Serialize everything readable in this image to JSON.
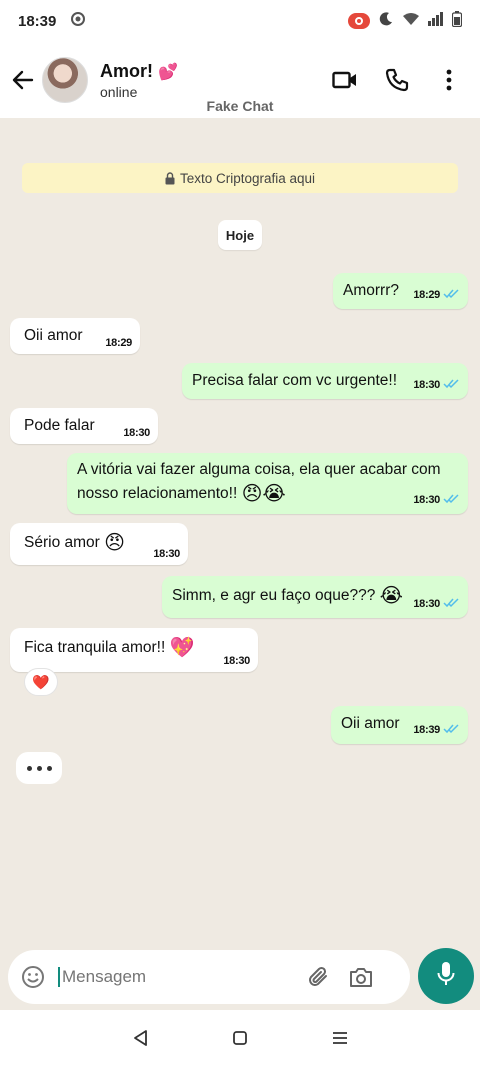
{
  "status_bar": {
    "time": "18:39"
  },
  "header": {
    "contact_name": "Amor!",
    "name_emoji": "💕",
    "status": "online",
    "app_label": "Fake Chat"
  },
  "chat": {
    "encryption_notice": "Texto Criptografia aqui",
    "date_divider": "Hoje",
    "messages": [
      {
        "dir": "out",
        "text": "Amorrr?",
        "time": "18:29",
        "read": true
      },
      {
        "dir": "in",
        "text": "Oii amor",
        "time": "18:29"
      },
      {
        "dir": "out",
        "text": "Precisa falar com vc urgente!!",
        "time": "18:30",
        "read": true
      },
      {
        "dir": "in",
        "text": "Pode falar",
        "time": "18:30"
      },
      {
        "dir": "out",
        "text_line1": "A vitória vai fazer alguma coisa, ela quer acabar com",
        "text_line2": "nosso relacionamento!!",
        "emojis": "😠😭",
        "time": "18:30",
        "read": true
      },
      {
        "dir": "in",
        "text": "Sério amor",
        "emoji": "😠",
        "time": "18:30"
      },
      {
        "dir": "out",
        "text": "Simm, e agr eu faço oque???",
        "emoji": "😭",
        "time": "18:30",
        "read": true
      },
      {
        "dir": "in",
        "text": "Fica tranquila amor!!",
        "emoji": "💖",
        "time": "18:30",
        "reaction": "❤️"
      },
      {
        "dir": "out",
        "text": "Oii amor",
        "time": "18:39",
        "read": true
      }
    ],
    "typing_indicator": "•••"
  },
  "input": {
    "placeholder": "Mensagem"
  },
  "colors": {
    "chat_bg": "#efeae2",
    "outgoing_bubble": "#d9fdd3",
    "incoming_bubble": "#ffffff",
    "read_ticks": "#53bdeb",
    "accent": "#128c7e",
    "encryption_banner": "#fcf4c5"
  },
  "icons": {
    "status": [
      "settings-icon",
      "record-icon",
      "moon-icon",
      "wifi-icon",
      "signal-icon",
      "battery-icon"
    ],
    "header": [
      "back-arrow-icon",
      "video-call-icon",
      "phone-icon",
      "more-vert-icon"
    ],
    "input": [
      "emoji-icon",
      "attach-icon",
      "camera-icon",
      "mic-icon"
    ],
    "nav": [
      "nav-back-icon",
      "nav-home-icon",
      "nav-recents-icon"
    ]
  }
}
